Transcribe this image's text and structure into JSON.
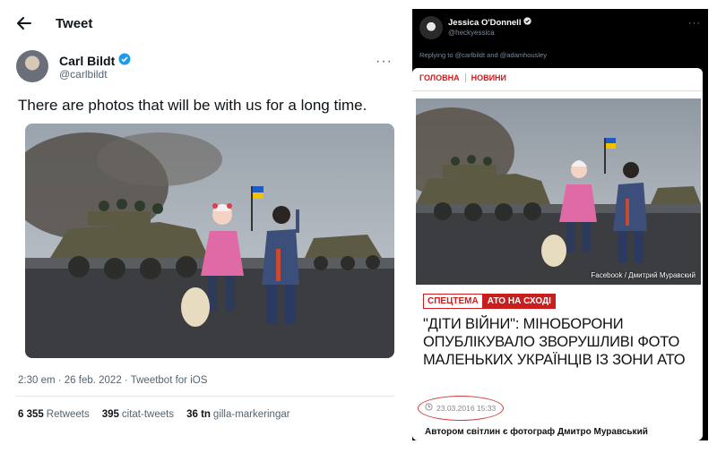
{
  "header": {
    "title": "Tweet"
  },
  "author": {
    "name": "Carl Bildt",
    "handle": "@carlbildt"
  },
  "tweet": {
    "text": "There are photos that will be with us for a long time.",
    "meta": "2:30 em · 26 feb. 2022 · Tweetbot for iOS"
  },
  "stats": [
    {
      "count": "6 355",
      "label": "Retweets"
    },
    {
      "count": "395",
      "label": "citat-tweets"
    },
    {
      "count": "36 tn",
      "label": "gilla-markeringar"
    }
  ],
  "reply": {
    "name": "Jessica O'Donnell",
    "handle": "@heckyessica",
    "replying_to": "Replying to @carlbildt and @adamhousley"
  },
  "article": {
    "nav_home": "ГОЛОВНА",
    "nav_news": "НОВИНИ",
    "photo_credit": "Facebook / Дмитрий Муравский",
    "tag_special": "СПЕЦТЕМА",
    "tag_ato": "АТО НА СХОДІ",
    "headline": "\"ДІТИ ВІЙНИ\": МІНОБОРОНИ ОПУБЛІКУВАЛО ЗВОРУШЛИВІ ФОТО МАЛЕНЬКИХ УКРАЇНЦІВ ІЗ ЗОНИ АТО",
    "date": "23.03.2016 15:33",
    "caption": "Автором світлин є фотограф Дмитро Муравський"
  },
  "colors": {
    "verified": "#1d9bf0",
    "accent_red": "#c81e1e"
  }
}
